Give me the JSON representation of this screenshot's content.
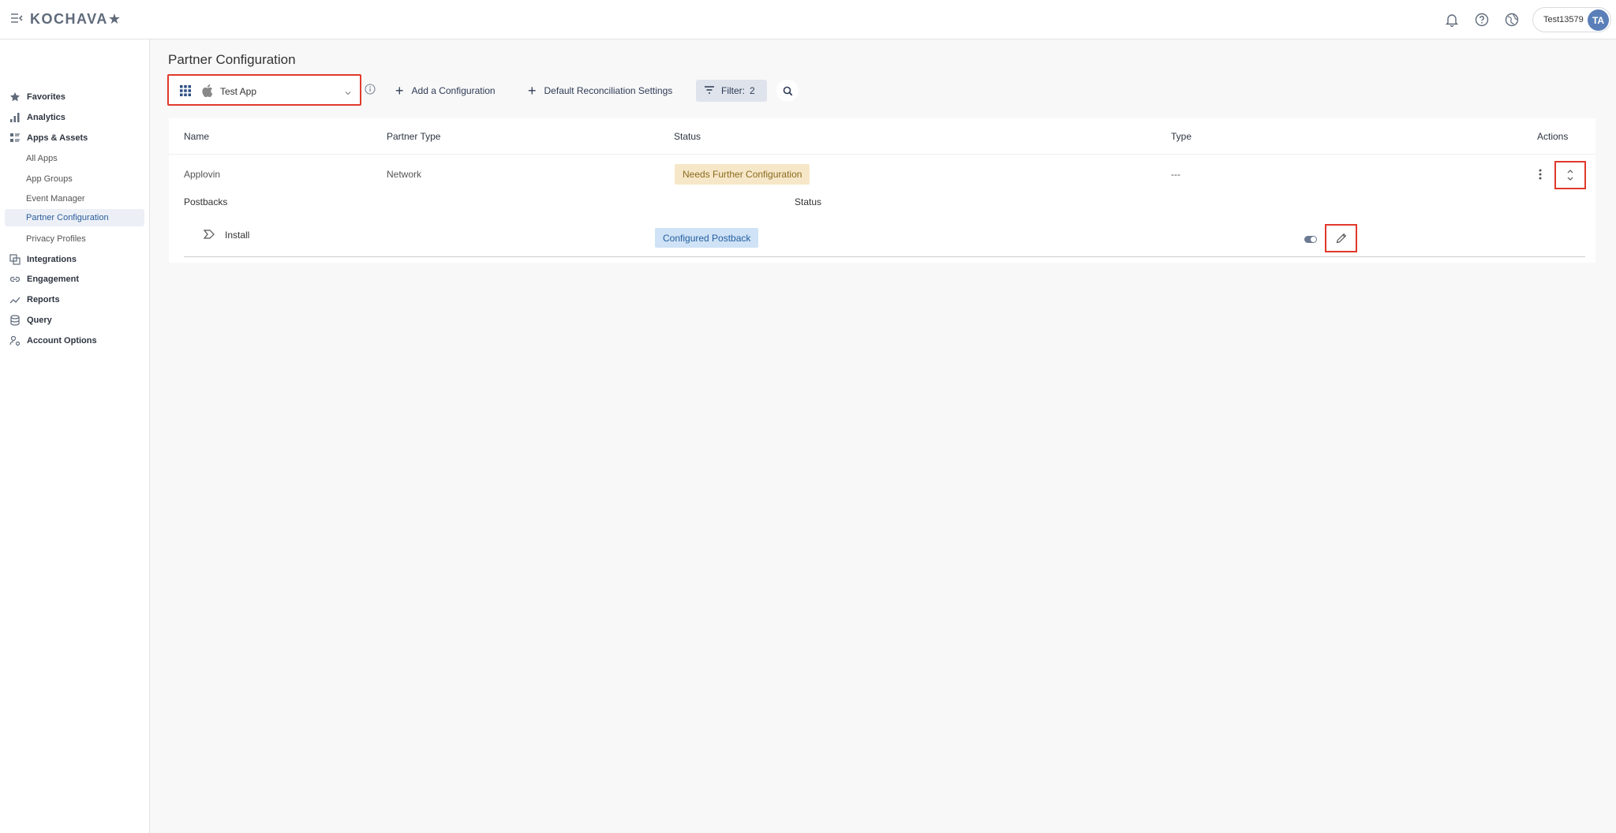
{
  "header": {
    "logo": "KOCHAVA★",
    "user_name": "Test13579",
    "avatar_initials": "TA"
  },
  "sidebar": {
    "items": [
      {
        "label": "Favorites",
        "icon": "star-icon"
      },
      {
        "label": "Analytics",
        "icon": "bar-chart-icon"
      },
      {
        "label": "Apps & Assets",
        "icon": "apps-list-icon"
      },
      {
        "label": "Integrations",
        "icon": "integrations-icon"
      },
      {
        "label": "Engagement",
        "icon": "link-icon"
      },
      {
        "label": "Reports",
        "icon": "trend-icon"
      },
      {
        "label": "Query",
        "icon": "database-icon"
      },
      {
        "label": "Account Options",
        "icon": "account-gear-icon"
      }
    ],
    "sub_items": [
      {
        "label": "All Apps"
      },
      {
        "label": "App Groups"
      },
      {
        "label": "Event Manager"
      },
      {
        "label": "Partner Configuration",
        "active": true
      },
      {
        "label": "Privacy Profiles"
      }
    ]
  },
  "page": {
    "title": "Partner Configuration"
  },
  "toolbar": {
    "app_select_value": "Test App",
    "add_configuration": "Add a Configuration",
    "default_reconciliation": "Default Reconciliation Settings",
    "filter_label": "Filter:",
    "filter_count": "2"
  },
  "table": {
    "headers": {
      "name": "Name",
      "partner_type": "Partner Type",
      "status": "Status",
      "type": "Type",
      "actions": "Actions"
    },
    "row": {
      "name": "Applovin",
      "partner_type": "Network",
      "status": "Needs Further Configuration",
      "type": "---"
    },
    "postbacks": {
      "label": "Postbacks",
      "status_header": "Status",
      "items": [
        {
          "name": "Install",
          "status": "Configured Postback"
        }
      ]
    }
  },
  "colors": {
    "highlight": "#e0392b",
    "active_nav": "#2d5c9b",
    "warn_badge": "#f6e7c8",
    "info_badge": "#cfe2f6"
  }
}
